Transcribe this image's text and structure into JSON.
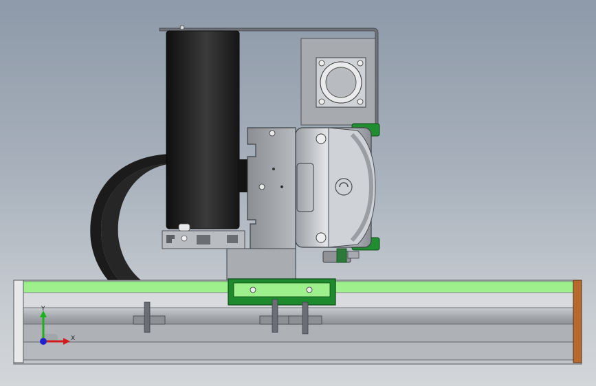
{
  "window": {
    "background_top": "#8e9aa9",
    "background_bottom": "#d3d6d9"
  },
  "triad": {
    "x_label": "X",
    "y_label": "Y",
    "x_color": "#d21c1c",
    "y_color": "#1bb21b",
    "origin_color": "#2222cc"
  },
  "colors": {
    "rail_highlight": "#9ef08c",
    "bracket_green": "#1e8a2e",
    "profile_gray": "#a9adb1",
    "wheel_black": "#1e1e1e",
    "end_cap_orange": "#b86a2e"
  }
}
